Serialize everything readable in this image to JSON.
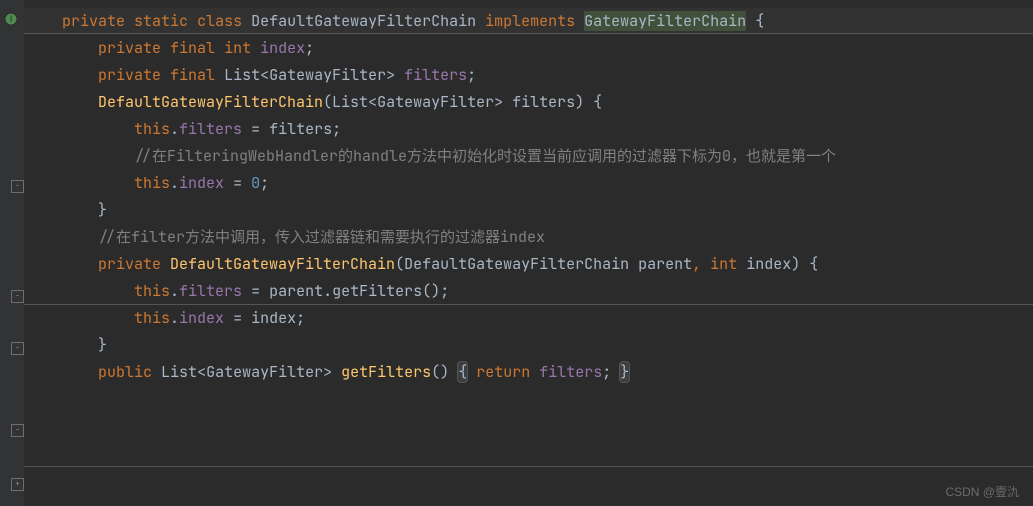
{
  "lang": {
    "private": "private",
    "static": "static",
    "class": "class",
    "implements": "implements",
    "final": "final",
    "int": "int",
    "this": "this",
    "public": "public",
    "return": "return"
  },
  "types": {
    "DefaultGatewayFilterChain": "DefaultGatewayFilterChain",
    "GatewayFilterChain": "GatewayFilterChain",
    "List": "List",
    "GatewayFilter": "GatewayFilter"
  },
  "fields": {
    "index": "index",
    "filters": "filters"
  },
  "ids": {
    "parent": "parent",
    "index": "index",
    "filters": "filters"
  },
  "methods": {
    "getFilters": "getFilters"
  },
  "numbers": {
    "zero": "0"
  },
  "comments": {
    "c1": "//在FilteringWebHandler的handle方法中初始化时设置当前应调用的过滤器下标为0，也就是第一个",
    "c2": "//在filter方法中调用，传入过滤器链和需要执行的过滤器index"
  },
  "punc": {
    "obrace": "{",
    "cbrace": "}",
    "semi": ";",
    "comma": ",",
    "eq": "=",
    "lt": "<",
    "gt": ">",
    "dot": ".",
    "op": "(",
    "cp": ")"
  },
  "icons": {
    "bulb": "●",
    "interface_impl": "I",
    "fold_minus": "-",
    "fold_plus": "+"
  },
  "watermark": "CSDN @壹氿"
}
